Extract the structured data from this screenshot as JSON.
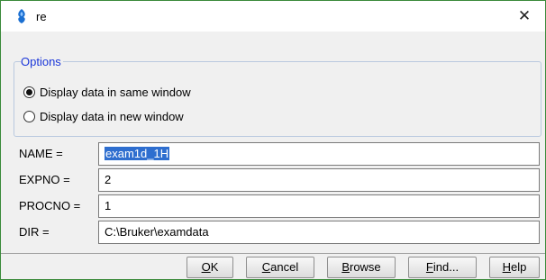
{
  "window": {
    "title": "re",
    "icon": "bruker-logo-icon",
    "close_glyph": "✕"
  },
  "options": {
    "legend": "Options",
    "radios": [
      {
        "label": "Display data in same window",
        "checked": true
      },
      {
        "label": "Display data in new window",
        "checked": false
      }
    ]
  },
  "fields": {
    "name": {
      "label": "NAME =",
      "value": "exam1d_1H",
      "selected": true
    },
    "expno": {
      "label": "EXPNO =",
      "value": "2"
    },
    "procno": {
      "label": "PROCNO =",
      "value": "1"
    },
    "dir": {
      "label": "DIR =",
      "value": "C:\\Bruker\\examdata"
    }
  },
  "buttons": {
    "ok": {
      "mnemonic": "O",
      "rest": "K"
    },
    "cancel": {
      "mnemonic": "C",
      "rest": "ancel"
    },
    "browse": {
      "mnemonic": "B",
      "rest": "rowse"
    },
    "find": {
      "mnemonic": "F",
      "rest": "ind..."
    },
    "help": {
      "mnemonic": "H",
      "rest": "elp"
    }
  },
  "colors": {
    "legend": "#1a36d9",
    "selection": "#2e6ecf",
    "window_border": "#3a8a3a"
  }
}
